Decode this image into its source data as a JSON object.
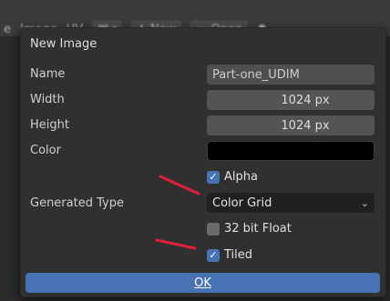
{
  "header": {
    "menu": [
      "e",
      "Image",
      "UV"
    ],
    "new_label": "New",
    "open_label": "Open"
  },
  "dialog": {
    "title": "New Image",
    "name": {
      "label": "Name",
      "value": "Part-one_UDIM"
    },
    "width": {
      "label": "Width",
      "value": "1024 px"
    },
    "height": {
      "label": "Height",
      "value": "1024 px"
    },
    "color": {
      "label": "Color",
      "value_hex": "#000000"
    },
    "alpha": {
      "label": "Alpha",
      "checked": true
    },
    "generated_type": {
      "label": "Generated Type",
      "value": "Color Grid"
    },
    "float": {
      "label": "32 bit Float",
      "checked": false
    },
    "tiled": {
      "label": "Tiled",
      "checked": true
    },
    "ok_label": "OK"
  },
  "annotations": {
    "arrow_color": "#e0203a"
  },
  "colors": {
    "accent": "#4772b3",
    "panel": "#303030",
    "field": "#545454"
  },
  "icons": {
    "image_menu": "image-icon",
    "new": "plus-icon",
    "open": "folder-icon",
    "pin": "pin-icon",
    "dropdown": "chevron-down-icon",
    "check": "checkmark-icon"
  }
}
